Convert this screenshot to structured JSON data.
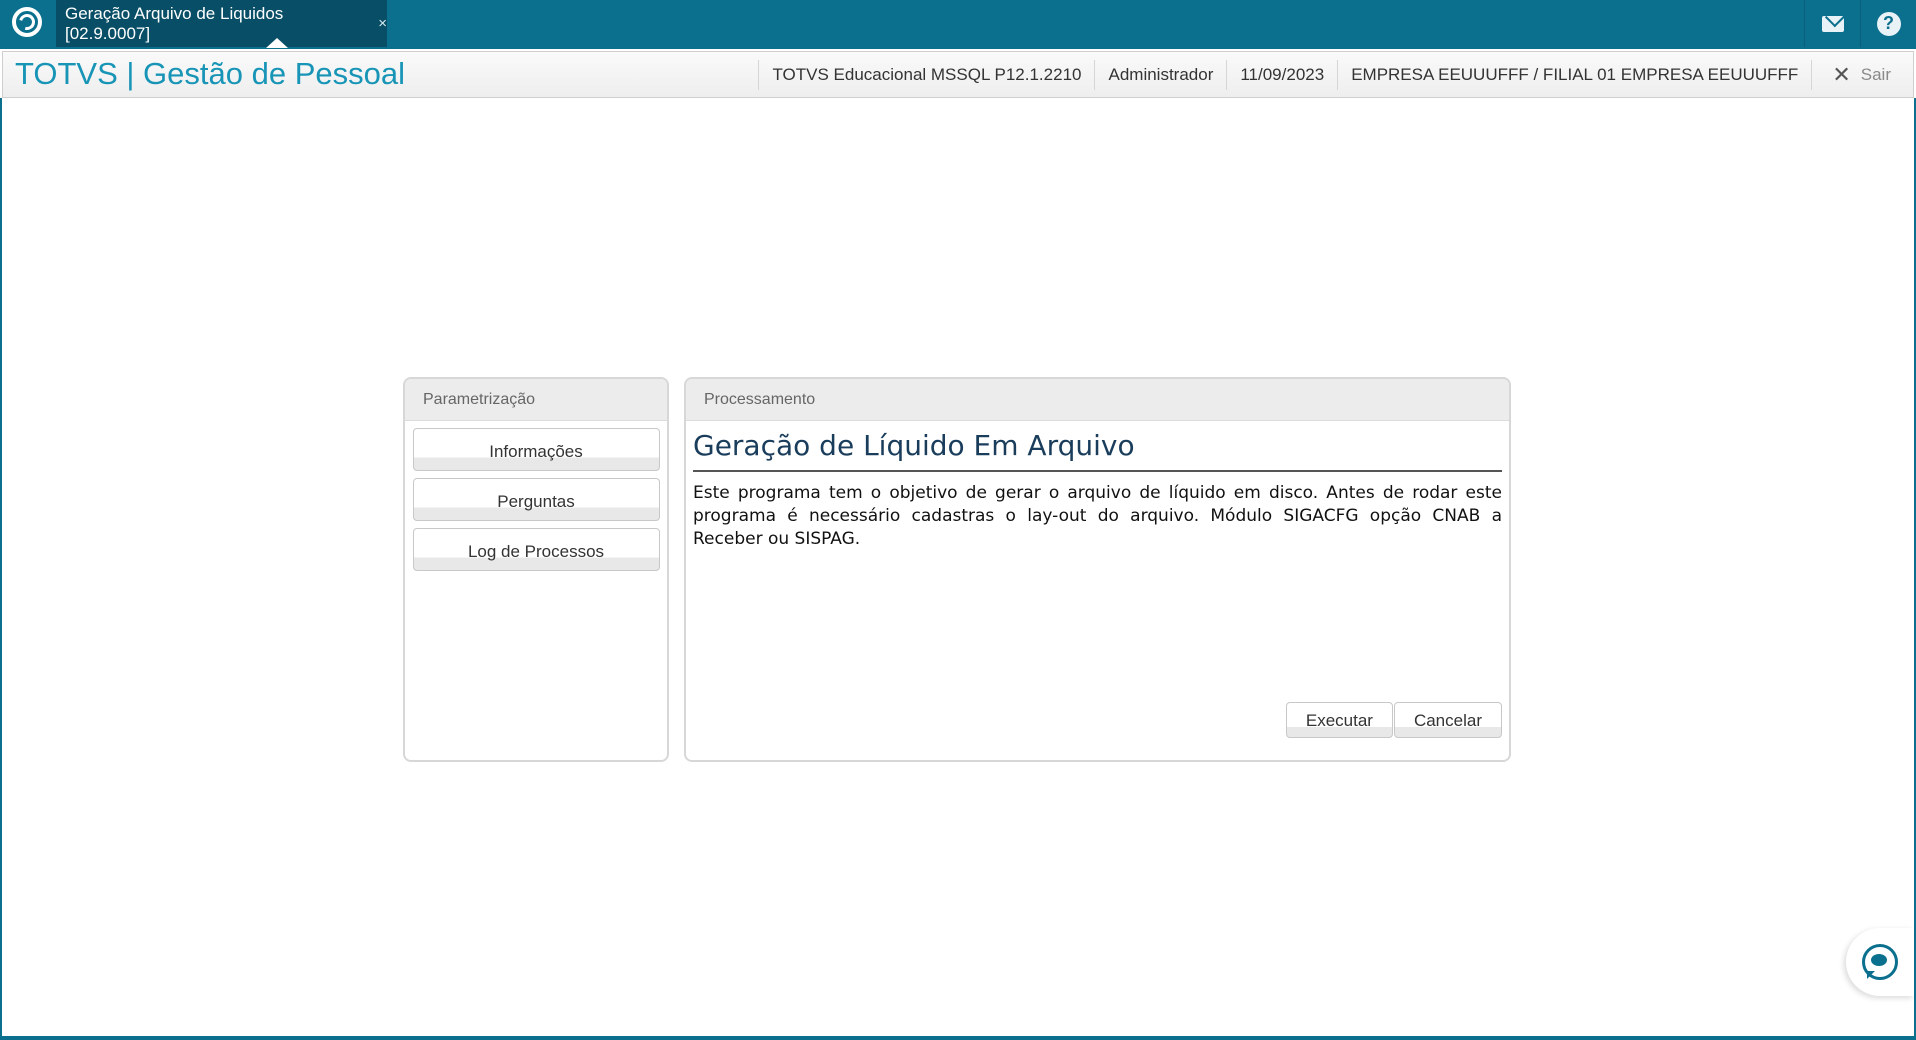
{
  "tab": {
    "title": "Geração Arquivo de Liquidos [02.9.0007]",
    "close": "×"
  },
  "topbar": {
    "mail_icon": "mail-icon",
    "help_icon": "help-icon",
    "help_glyph": "?"
  },
  "header": {
    "app_title": "TOTVS | Gestão de Pessoal",
    "environment": "TOTVS Educacional MSSQL P12.1.2210",
    "user": "Administrador",
    "date": "11/09/2023",
    "company": "EMPRESA EEUUUFFF / FILIAL 01 EMPRESA EEUUUFFF",
    "logout_label": "Sair",
    "logout_glyph": "✕"
  },
  "param_panel": {
    "title": "Parametrização",
    "buttons": [
      "Informações",
      "Perguntas",
      "Log de Processos"
    ]
  },
  "proc_panel": {
    "title": "Processamento",
    "heading": "Geração de Líquido Em Arquivo",
    "description": "Este programa tem o objetivo de gerar o arquivo de líquido em disco. Antes de rodar este programa é necessário cadastras o lay-out do arquivo. Módulo SIGACFG opção CNAB a Receber ou SISPAG.",
    "execute_label": "Executar",
    "cancel_label": "Cancelar"
  },
  "colors": {
    "topbar": "#0b6f8e",
    "tab_active": "#074e66",
    "title_accent": "#1895b6"
  }
}
